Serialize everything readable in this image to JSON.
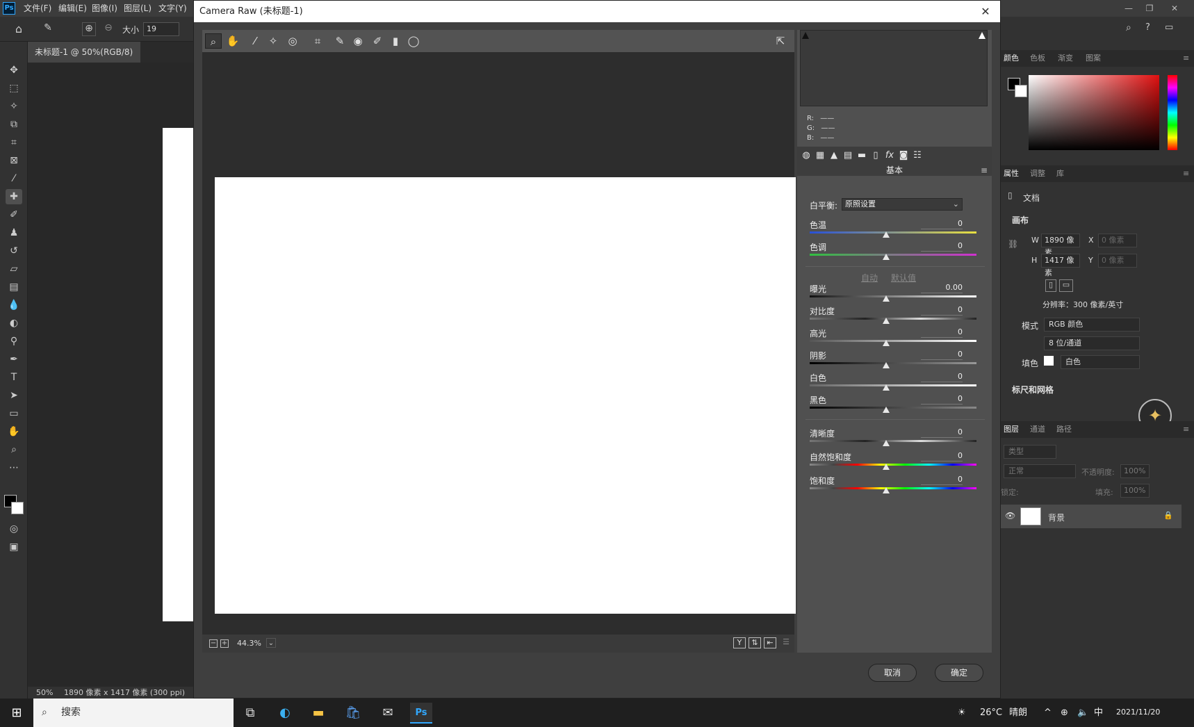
{
  "app": {
    "logo": "Ps",
    "menus": [
      "文件(F)",
      "编辑(E)",
      "图像(I)",
      "图层(L)",
      "文字(Y)"
    ],
    "window_controls": {
      "minimize": "—",
      "restore": "❐",
      "close": "✕"
    }
  },
  "options_bar": {
    "size_label": "大小",
    "size_value": "19"
  },
  "document": {
    "tab_title": "未标题-1 @ 50%(RGB/8)",
    "tab_close": "×",
    "zoom": "50%",
    "info": "1890 像素 x 1417 像素 (300 ppi)"
  },
  "camera_raw": {
    "title": "Camera Raw (未标题-1)",
    "close": "✕",
    "zoom_value": "44.3%",
    "rgb": {
      "r_label": "R:",
      "g_label": "G:",
      "b_label": "B:",
      "r": "——",
      "g": "——",
      "b": "——"
    },
    "panel_title": "基本",
    "white_balance_label": "白平衡:",
    "white_balance_value": "原照设置",
    "auto_label": "自动",
    "default_label": "默认值",
    "sliders": {
      "temperature": {
        "label": "色温",
        "value": "0"
      },
      "tint": {
        "label": "色调",
        "value": "0"
      },
      "exposure": {
        "label": "曝光",
        "value": "0.00"
      },
      "contrast": {
        "label": "对比度",
        "value": "0"
      },
      "highlights": {
        "label": "高光",
        "value": "0"
      },
      "shadows": {
        "label": "阴影",
        "value": "0"
      },
      "whites": {
        "label": "白色",
        "value": "0"
      },
      "blacks": {
        "label": "黑色",
        "value": "0"
      },
      "clarity": {
        "label": "清晰度",
        "value": "0"
      },
      "vibrance": {
        "label": "自然饱和度",
        "value": "0"
      },
      "saturation": {
        "label": "饱和度",
        "value": "0"
      }
    },
    "cancel_label": "取消",
    "ok_label": "确定"
  },
  "right_panel": {
    "color_tabs": [
      "颜色",
      "色板",
      "渐变",
      "图案"
    ],
    "props_tabs": [
      "属性",
      "调整",
      "库"
    ],
    "doc_label": "文档",
    "canvas_section": "画布",
    "w_label": "W",
    "w_value": "1890 像素",
    "h_label": "H",
    "h_value": "1417 像素",
    "x_label": "X",
    "x_placeholder": "0 像素",
    "y_label": "Y",
    "y_placeholder": "0 像素",
    "resolution": "分辨率：300 像素/英寸",
    "mode_label": "模式",
    "mode_value": "RGB 颜色",
    "depth_value": "8 位/通道",
    "fill_label": "填色",
    "fill_value": "白色",
    "rulers_section": "标尺和网格",
    "layer_tabs": [
      "图层",
      "通道",
      "路径"
    ],
    "layer_filter": "类型",
    "blend_mode": "正常",
    "opacity_label": "不透明度:",
    "opacity_value": "100%",
    "lock_label": "锁定:",
    "fill_pct_label": "填充:",
    "fill_pct_value": "100%",
    "layer_name": "背景"
  },
  "taskbar": {
    "search_label": "搜索",
    "weather": "26°C",
    "weather_desc": "晴朗",
    "ime": "中",
    "date": "2021/11/20"
  },
  "colors": {
    "accent_ps": "#31a8ff",
    "dialog_bg": "#3f3f3f"
  }
}
